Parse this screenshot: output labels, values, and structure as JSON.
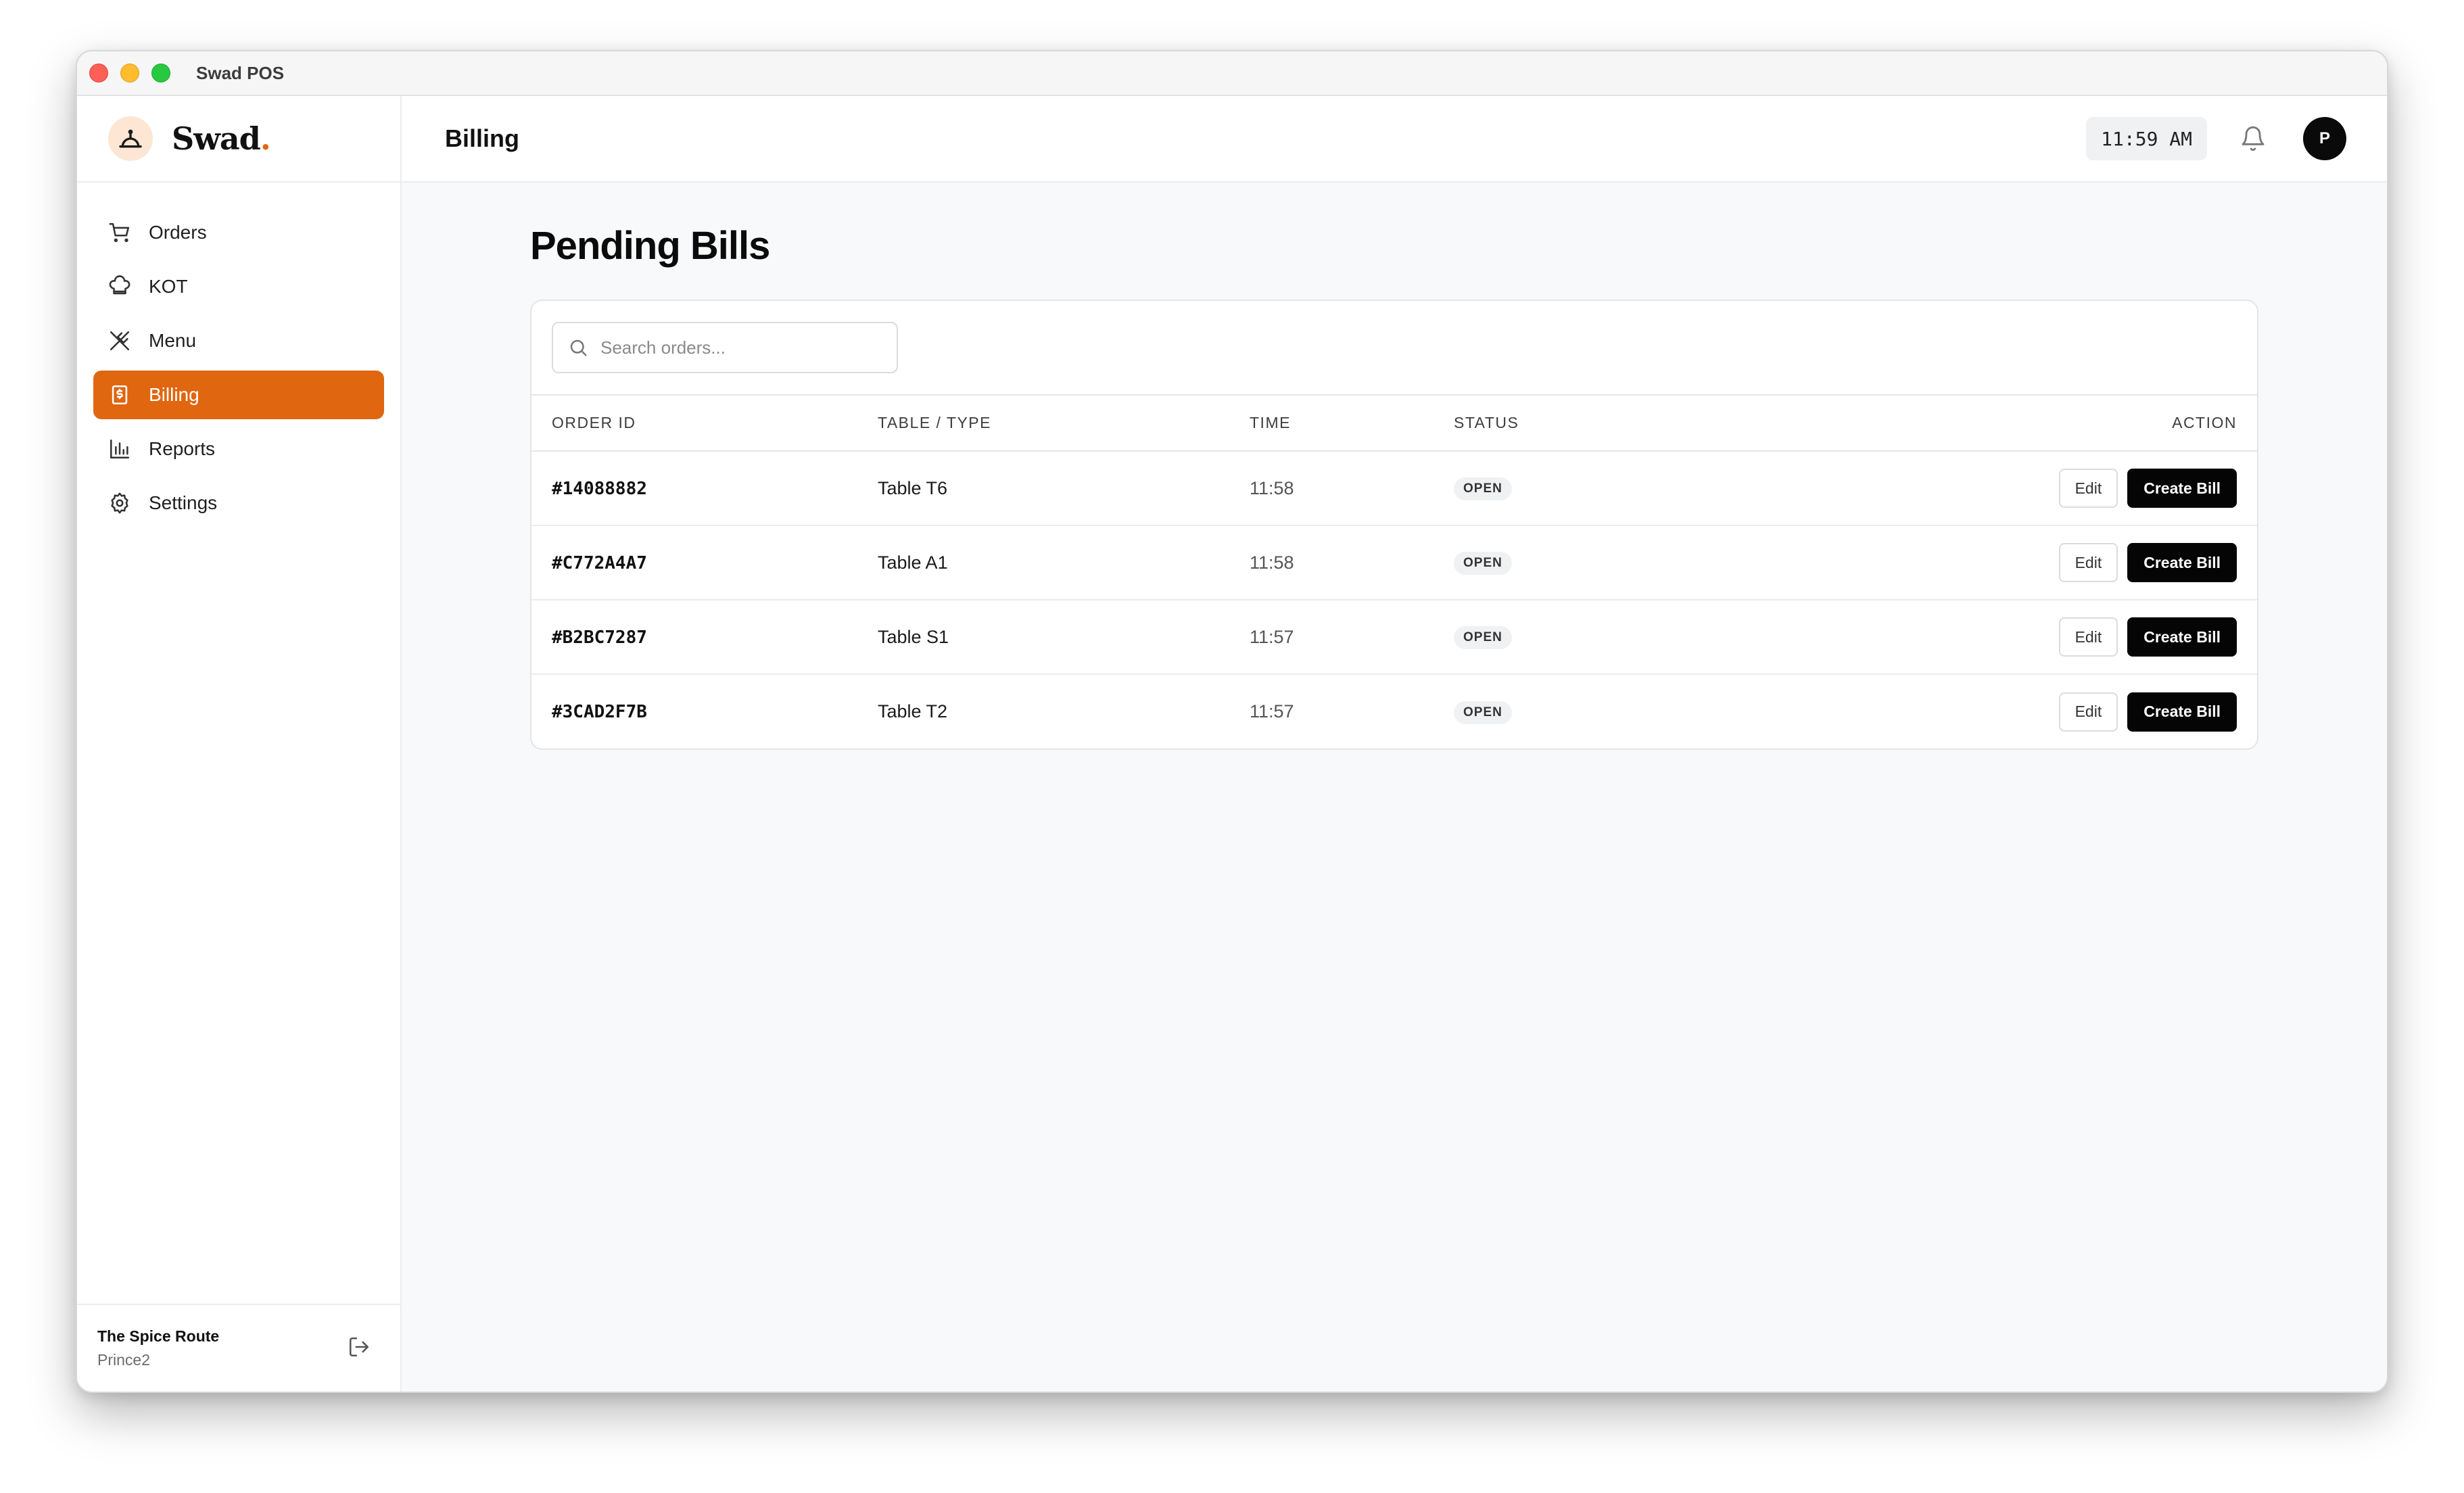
{
  "window": {
    "title": "Swad POS"
  },
  "brand": {
    "name": "Swad",
    "dot": ".",
    "accent_color": "#e06610"
  },
  "sidebar": {
    "items": [
      {
        "label": "Orders",
        "icon": "cart-icon",
        "active": false
      },
      {
        "label": "KOT",
        "icon": "chef-hat-icon",
        "active": false
      },
      {
        "label": "Menu",
        "icon": "utensils-icon",
        "active": false
      },
      {
        "label": "Billing",
        "icon": "receipt-icon",
        "active": true
      },
      {
        "label": "Reports",
        "icon": "bar-chart-icon",
        "active": false
      },
      {
        "label": "Settings",
        "icon": "gear-icon",
        "active": false
      }
    ],
    "footer": {
      "store": "The Spice Route",
      "user": "Prince2",
      "icon": "logout-icon"
    }
  },
  "header": {
    "title": "Billing",
    "clock": "11:59 AM",
    "avatar_initial": "P"
  },
  "main": {
    "page_title": "Pending Bills",
    "search": {
      "placeholder": "Search orders...",
      "value": ""
    },
    "table": {
      "columns": [
        "ORDER ID",
        "TABLE / TYPE",
        "TIME",
        "STATUS",
        "ACTION"
      ],
      "rows": [
        {
          "order_id": "#14088882",
          "table": "Table T6",
          "time": "11:58",
          "status": "OPEN"
        },
        {
          "order_id": "#C772A4A7",
          "table": "Table A1",
          "time": "11:58",
          "status": "OPEN"
        },
        {
          "order_id": "#B2BC7287",
          "table": "Table S1",
          "time": "11:57",
          "status": "OPEN"
        },
        {
          "order_id": "#3CAD2F7B",
          "table": "Table T2",
          "time": "11:57",
          "status": "OPEN"
        }
      ],
      "edit_label": "Edit",
      "create_label": "Create Bill"
    }
  }
}
